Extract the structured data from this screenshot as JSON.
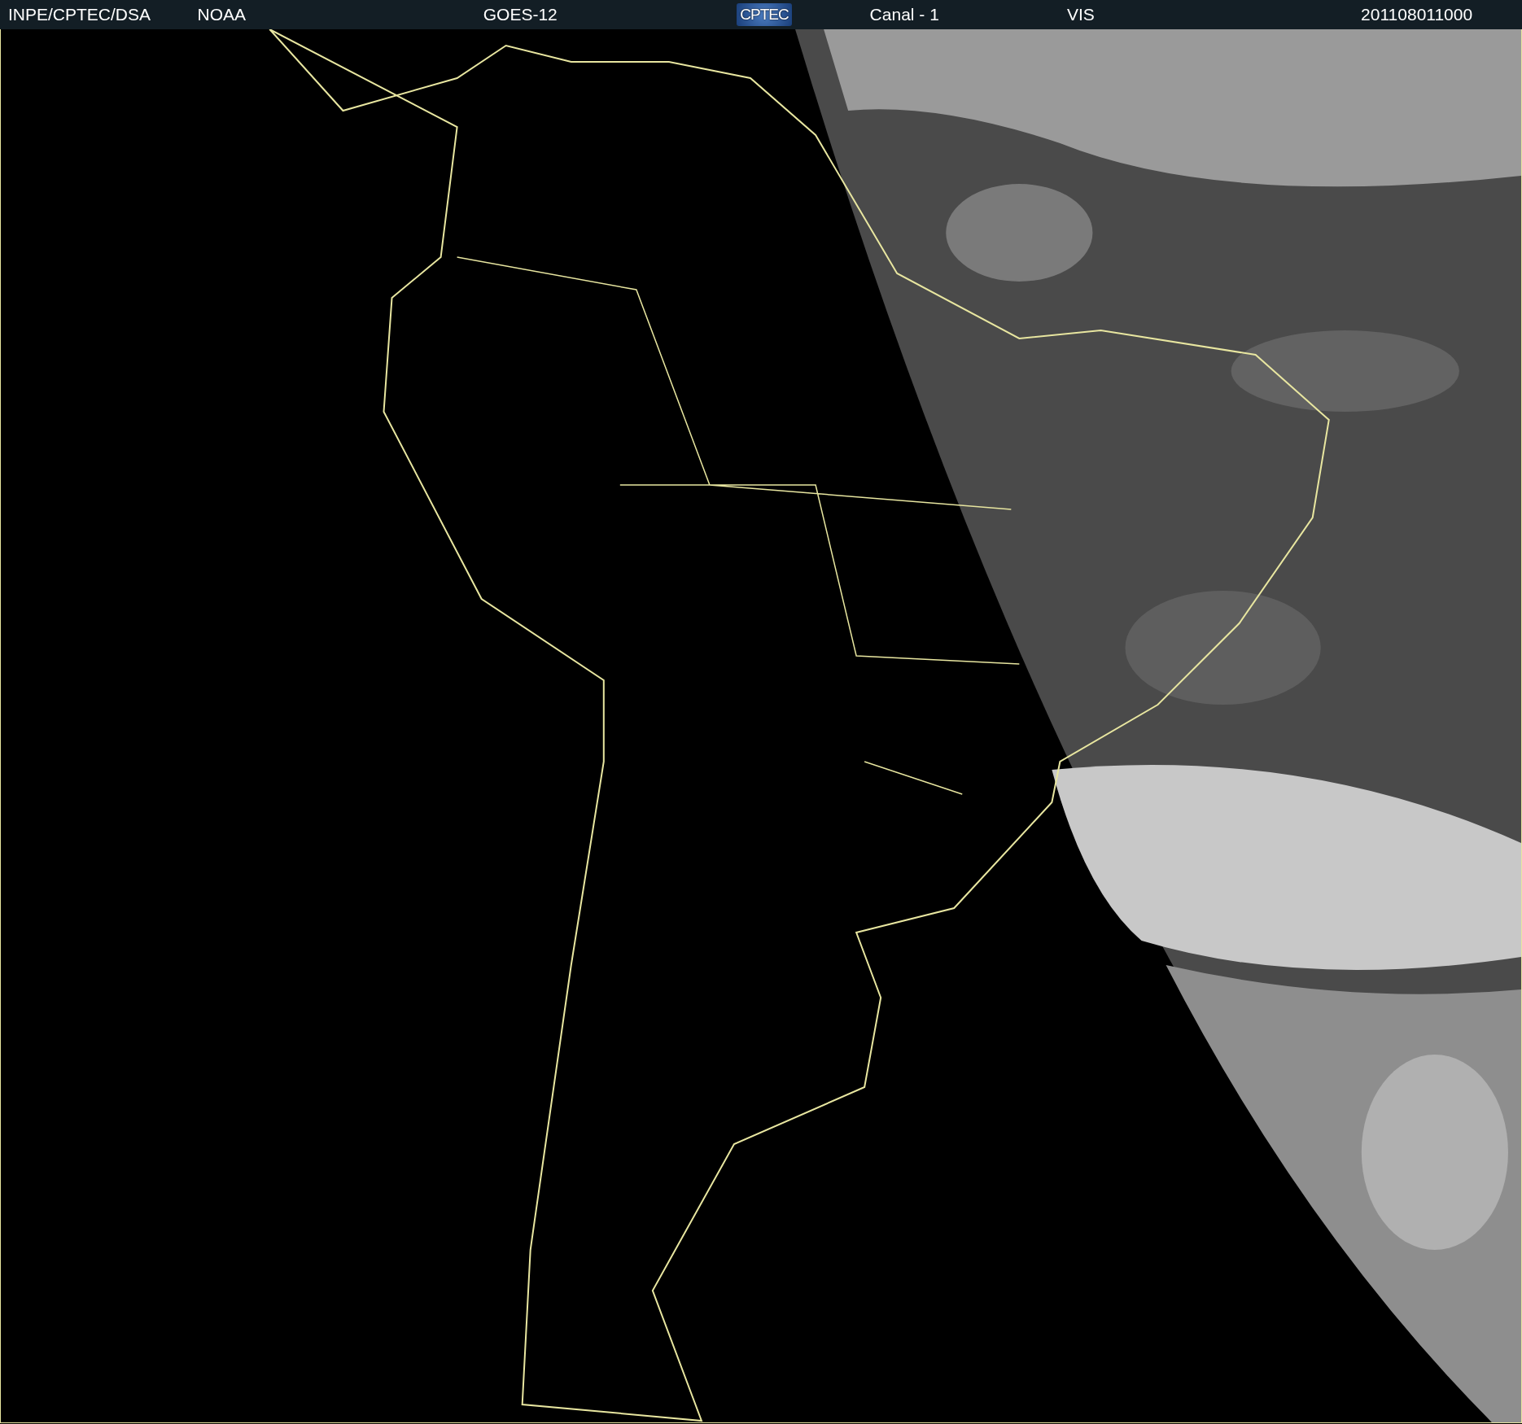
{
  "header": {
    "items": [
      {
        "kind": "text",
        "text": "INPE/CPTEC/DSA"
      },
      {
        "kind": "text",
        "text": "NOAA"
      },
      {
        "kind": "text",
        "text": "GOES-12"
      },
      {
        "kind": "logo",
        "text": "CPTEC"
      },
      {
        "kind": "text",
        "text": "Canal - 1"
      },
      {
        "kind": "text",
        "text": "VIS"
      },
      {
        "kind": "text",
        "text": "201108011000"
      }
    ]
  }
}
